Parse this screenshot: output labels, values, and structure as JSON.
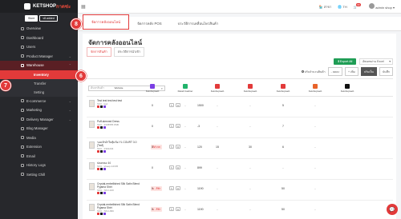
{
  "brand": {
    "name": "KETSHOP",
    "suffix": "กาดซ่ะ",
    "ver_a": "Store",
    "ver_b": "v8.added"
  },
  "sidebar": {
    "items": [
      {
        "label": "Overview",
        "icon": "home-icon"
      },
      {
        "label": "Dashboard",
        "icon": "dashboard-icon"
      },
      {
        "label": "Users",
        "icon": "users-icon"
      },
      {
        "label": "Product Manager",
        "icon": "box-icon"
      },
      {
        "label": "Warehouse",
        "icon": "warehouse-icon"
      },
      {
        "label": "E-commerce",
        "icon": "cart-icon"
      },
      {
        "label": "Marketing",
        "icon": "megaphone-icon"
      },
      {
        "label": "Delivery Manager",
        "icon": "truck-icon"
      },
      {
        "label": "Blog Manager",
        "icon": "blog-icon"
      },
      {
        "label": "Media",
        "icon": "media-icon"
      },
      {
        "label": "Extension",
        "icon": "puzzle-icon"
      },
      {
        "label": "Email",
        "icon": "mail-icon"
      },
      {
        "label": "History Logs",
        "icon": "history-icon"
      },
      {
        "label": "Setting Chill",
        "icon": "gear-icon"
      }
    ],
    "warehouse_sub": [
      {
        "label": "Inventory"
      },
      {
        "label": "Transfer"
      },
      {
        "label": "Setting"
      }
    ]
  },
  "topbar": {
    "branch": "สาขา",
    "lang": "TH",
    "cart_count": "99",
    "user": "admin shop"
  },
  "tabs": [
    {
      "label": "จัดการคลังออนไลน์"
    },
    {
      "label": "จัดการคลัง POS"
    },
    {
      "label": "ประวัติการเคลื่อนไหวสินค้า"
    }
  ],
  "page": {
    "title": "จัดการคลังออนไลน์",
    "subtabs": [
      {
        "label": "จัดการสินค้า"
      },
      {
        "label": "ประวัติการนำเข้า"
      }
    ],
    "export_label": "Export All",
    "excel_label": "อัพเดทผ่าน Excel",
    "radio_label": "ปรับจำนวนสินค้า",
    "btn_sub": "- ลดลง",
    "btn_add": "+ เพิ่ม",
    "btn_adjust": "ปรับเป็น",
    "btn_save": "บันทึก",
    "search_placeholder": "ค้นหาสินค้า"
  },
  "table": {
    "headers": [
      {
        "label": "Website",
        "color": ""
      },
      {
        "label": "Ketshopweb",
        "color": "#7b3fe4"
      },
      {
        "label": "Retail Cashier",
        "color": "#21b36b"
      },
      {
        "label": "Ketshopweb",
        "color": "#e23a3a"
      },
      {
        "label": "Ketshopweb",
        "color": "#e23a3a"
      },
      {
        "label": "Ketshopweb",
        "color": "#e23a3a"
      },
      {
        "label": "Ketshopweb",
        "color": "#e8632a"
      },
      {
        "label": "Ketshopweb",
        "color": "#111111"
      }
    ],
    "rows": [
      {
        "name": "Test test test test test",
        "sku": "SKU : kgz",
        "tag": "",
        "price": "1500",
        "vals": [
          "0",
          "-",
          "-",
          "-",
          "5",
          "-"
        ]
      },
      {
        "name": "Puff-sleeved Dress",
        "sku": "SKU : 2345555 8SB",
        "tag": "",
        "price": "-3",
        "vals": [
          "0",
          "-",
          "-",
          "-",
          "7",
          "-"
        ]
      },
      {
        "name": "รองเท้าผ้าใบหุ้มข้อ YL COURT 3.0 (ไซส์)",
        "sku": "SKU : 2301234",
        "tag": "สีดำ/38",
        "price": "120",
        "vals": [
          "0",
          "-",
          "15",
          "30",
          "6",
          "-"
        ]
      },
      {
        "name": "ปลอกคอ 44",
        "sku": "SKU : sheep-12345",
        "tag": "",
        "price": "899",
        "vals": [
          "0",
          "-",
          "-",
          "-",
          "-",
          "-"
        ]
      },
      {
        "name": "Crystal-embellished Silk Satin Blend Pyjama Shirt",
        "sku": "SKU : SKU-100",
        "tag": "S - สีฟ้า",
        "price": "1190",
        "vals": [
          "0",
          "-",
          "-",
          "-",
          "50",
          "-"
        ]
      },
      {
        "name": "Crystal-embellished Silk Satin Blend Pyjama Shirt",
        "sku": "SKU : SKU-999",
        "tag": "S - สีฟ้า",
        "price": "1190",
        "vals": [
          "0",
          "-",
          "-",
          "-",
          "50",
          "-"
        ]
      }
    ]
  },
  "markers": {
    "m6": "6",
    "m7": "7",
    "m8": "8"
  }
}
